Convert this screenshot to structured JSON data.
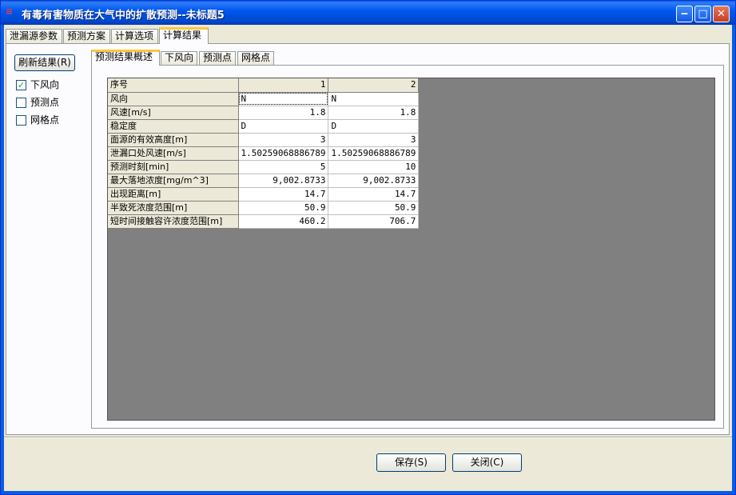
{
  "window": {
    "title": "有毒有害物质在大气中的扩散预测--未标题5",
    "icon": "app-icon",
    "controls": [
      "minimize-icon",
      "maximize-icon",
      "close-icon"
    ]
  },
  "main_tabs": [
    "泄漏源参数",
    "预测方案",
    "计算选项",
    "计算结果"
  ],
  "main_tabs_active": "计算结果",
  "sidebar": {
    "refresh_label": "刷新结果(R)",
    "checkboxes": [
      {
        "label": "下风向",
        "checked": true
      },
      {
        "label": "预测点",
        "checked": false
      },
      {
        "label": "网格点",
        "checked": false
      }
    ]
  },
  "sub_tabs": [
    "预测结果概述",
    "下风向",
    "预测点",
    "网格点"
  ],
  "sub_tabs_active": "预测结果概述",
  "grid": {
    "header": {
      "label": "序号",
      "col1": "1",
      "col2": "2"
    },
    "rows": [
      {
        "label": "风向",
        "col1": "N",
        "col2": "N",
        "align": "left"
      },
      {
        "label": "风速[m/s]",
        "col1": "1.8",
        "col2": "1.8",
        "align": "right"
      },
      {
        "label": "稳定度",
        "col1": "D",
        "col2": "D",
        "align": "left"
      },
      {
        "label": "面源的有效高度[m]",
        "col1": "3",
        "col2": "3",
        "align": "right"
      },
      {
        "label": "泄漏口处风速[m/s]",
        "col1": "1.50259068886789",
        "col2": "1.50259068886789",
        "align": "right"
      },
      {
        "label": "预测时刻[min]",
        "col1": "5",
        "col2": "10",
        "align": "right"
      },
      {
        "label": "最大落地浓度[mg/m^3]",
        "col1": "9,002.8733",
        "col2": "9,002.8733",
        "align": "right"
      },
      {
        "label": "出现距离[m]",
        "col1": "14.7",
        "col2": "14.7",
        "align": "right"
      },
      {
        "label": "半致死浓度范围[m]",
        "col1": "50.9",
        "col2": "50.9",
        "align": "right"
      },
      {
        "label": "短时间接触容许浓度范围[m]",
        "col1": "460.2",
        "col2": "706.7",
        "align": "right"
      }
    ]
  },
  "footer": {
    "save_label": "保存(S)",
    "close_label": "关闭(C)"
  },
  "colors": {
    "titlebar": "#0058ee",
    "tab_highlight": "#ffc83c",
    "grid_background": "#808080",
    "check_mark": "#21a121"
  }
}
